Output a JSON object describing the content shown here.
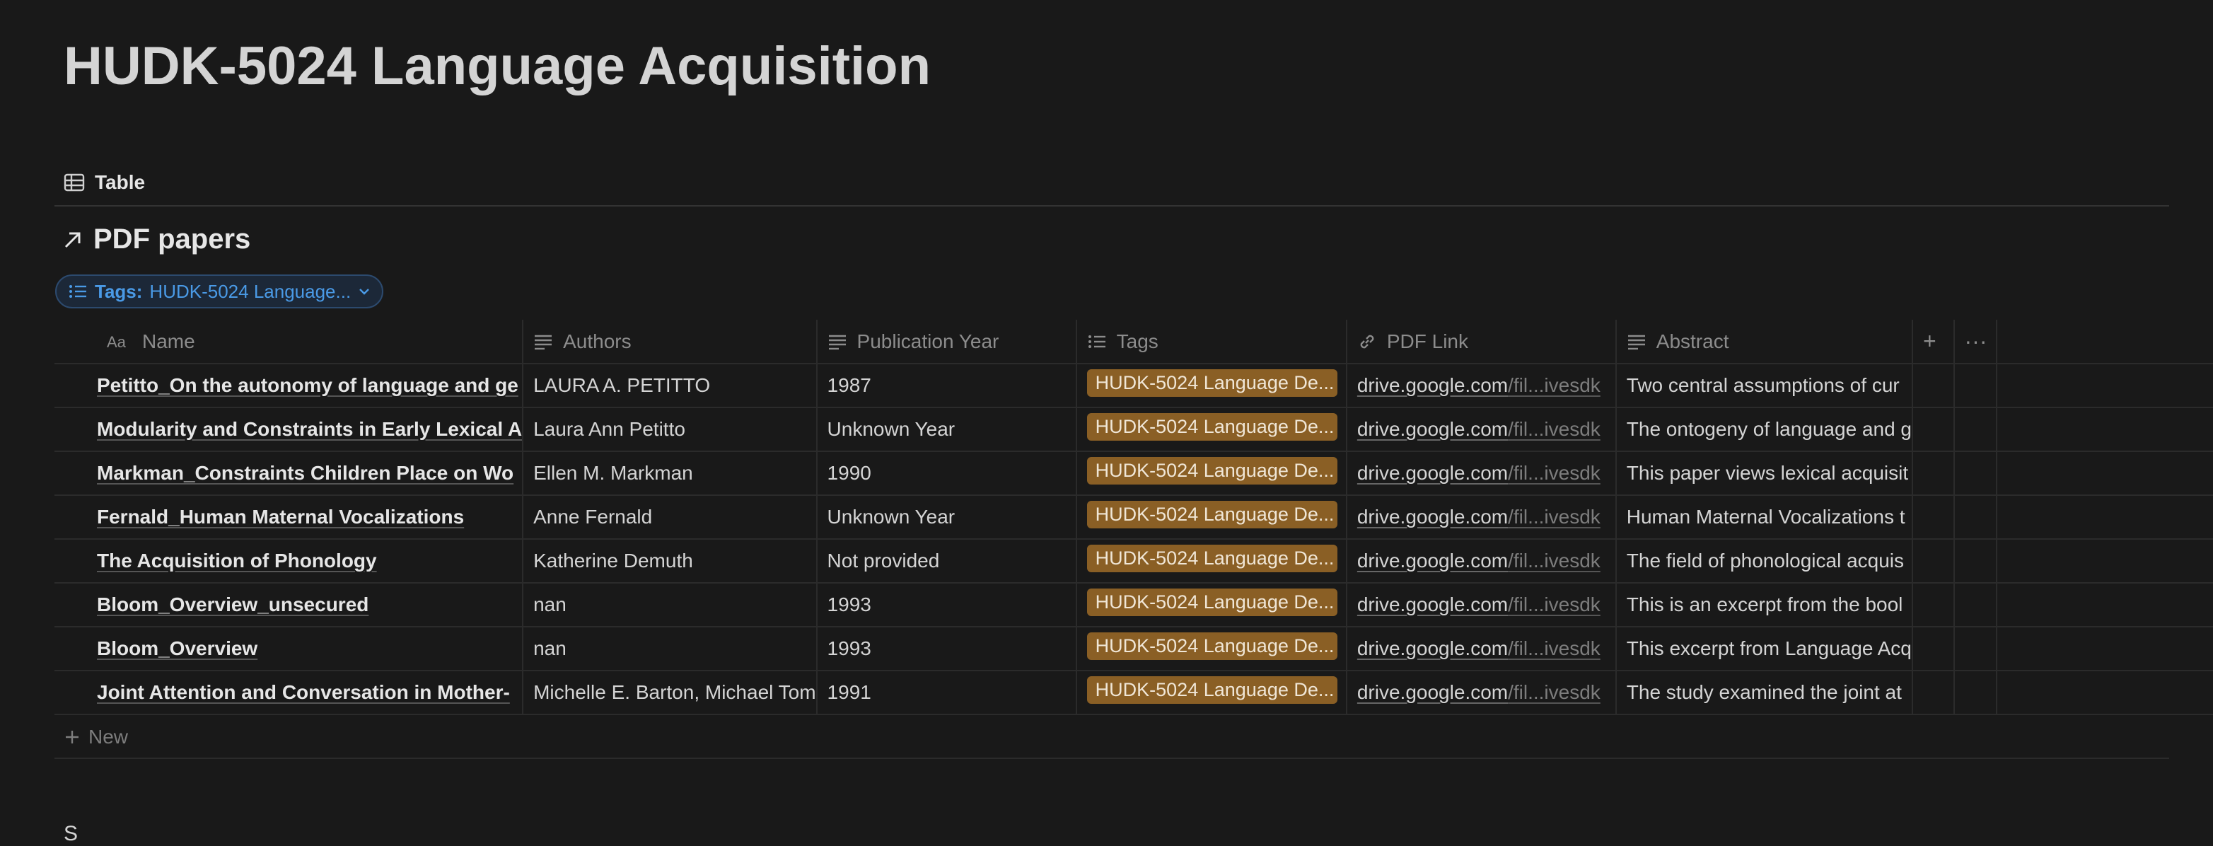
{
  "page": {
    "title": "HUDK-5024 Language Acquisition"
  },
  "view": {
    "tab_label": "Table",
    "tab_icon": "table-icon"
  },
  "database": {
    "title": "PDF papers",
    "title_icon": "arrow-up-right-icon"
  },
  "filter": {
    "key": "Tags:",
    "value": "HUDK-5024 Language...",
    "icon": "list-icon"
  },
  "columns": [
    {
      "label": "Name",
      "icon": "text-aa-icon"
    },
    {
      "label": "Authors",
      "icon": "text-lines-icon"
    },
    {
      "label": "Publication Year",
      "icon": "text-lines-icon"
    },
    {
      "label": "Tags",
      "icon": "list-icon"
    },
    {
      "label": "PDF Link",
      "icon": "link-icon"
    },
    {
      "label": "Abstract",
      "icon": "text-lines-icon"
    }
  ],
  "rows": [
    {
      "name": "Petitto_On the autonomy of language and ge",
      "authors": "LAURA A. PETITTO",
      "year": "1987",
      "tag": "HUDK-5024 Language De...",
      "link_domain": "drive.google.com",
      "link_rest": "/fil...ivesdk",
      "abstract": "Two central assumptions of cur"
    },
    {
      "name": "Modularity and Constraints in Early Lexical A",
      "authors": "Laura Ann Petitto",
      "year": "Unknown Year",
      "tag": "HUDK-5024 Language De...",
      "link_domain": "drive.google.com",
      "link_rest": "/fil...ivesdk",
      "abstract": "The ontogeny of language and g"
    },
    {
      "name": "Markman_Constraints Children Place on Wo",
      "authors": "Ellen M. Markman",
      "year": "1990",
      "tag": "HUDK-5024 Language De...",
      "link_domain": "drive.google.com",
      "link_rest": "/fil...ivesdk",
      "abstract": "This paper views lexical acquisit"
    },
    {
      "name": "Fernald_Human Maternal Vocalizations",
      "authors": "Anne Fernald",
      "year": "Unknown Year",
      "tag": "HUDK-5024 Language De...",
      "link_domain": "drive.google.com",
      "link_rest": "/fil...ivesdk",
      "abstract": "Human Maternal Vocalizations t"
    },
    {
      "name": "The Acquisition of Phonology",
      "authors": "Katherine Demuth",
      "year": "Not provided",
      "tag": "HUDK-5024 Language De...",
      "link_domain": "drive.google.com",
      "link_rest": "/fil...ivesdk",
      "abstract": "The field of phonological acquis"
    },
    {
      "name": "Bloom_Overview_unsecured",
      "authors": "nan",
      "year": "1993",
      "tag": "HUDK-5024 Language De...",
      "link_domain": "drive.google.com",
      "link_rest": "/fil...ivesdk",
      "abstract": "This is an excerpt from the bool"
    },
    {
      "name": "Bloom_Overview",
      "authors": "nan",
      "year": "1993",
      "tag": "HUDK-5024 Language De...",
      "link_domain": "drive.google.com",
      "link_rest": "/fil...ivesdk",
      "abstract": "This excerpt from Language Acq"
    },
    {
      "name": "Joint Attention and Conversation in Mother-",
      "authors": "Michelle E. Barton, Michael Tom",
      "year": "1991",
      "tag": "HUDK-5024 Language De...",
      "link_domain": "drive.google.com",
      "link_rest": "/fil...ivesdk",
      "abstract": "The study examined the joint at"
    }
  ],
  "new_row_label": "New",
  "add_column_glyph": "+",
  "more_glyph": "···",
  "trailing_text": "S",
  "colors": {
    "background": "#191919",
    "tag_bg": "#8a5f25",
    "filter_text": "#4a9ae6"
  }
}
